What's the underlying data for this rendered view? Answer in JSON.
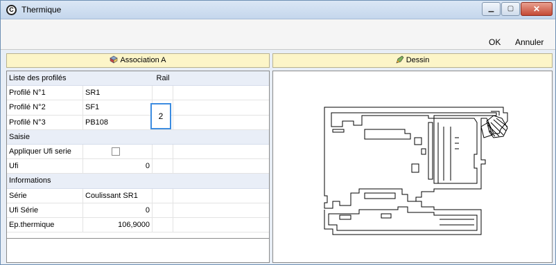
{
  "window": {
    "title": "Thermique",
    "app_icon_glyph": "C"
  },
  "toolbar": {
    "ok_label": "OK",
    "cancel_label": "Annuler"
  },
  "panels": {
    "left_title": "Association A",
    "right_title": "Dessin"
  },
  "grid": {
    "header": {
      "label": "Liste des profilés",
      "rail": "Rail"
    },
    "profiles": [
      {
        "label": "Profilé N°1",
        "value": "SR1"
      },
      {
        "label": "Profilé N°2",
        "value": "SF1"
      },
      {
        "label": "Profilé N°3",
        "value": "PB108"
      }
    ],
    "rail_value": "2",
    "saisie": {
      "section": "Saisie",
      "apply_label": "Appliquer Ufi serie",
      "apply_checked": false,
      "ufi_label": "Ufi",
      "ufi_value": "0"
    },
    "informations": {
      "section": "Informations",
      "serie_label": "Série",
      "serie_value": "Coulissant SR1",
      "ufi_serie_label": "Ufi Série",
      "ufi_serie_value": "0",
      "ep_label": "Ep.thermique",
      "ep_value": "106,9000"
    }
  }
}
